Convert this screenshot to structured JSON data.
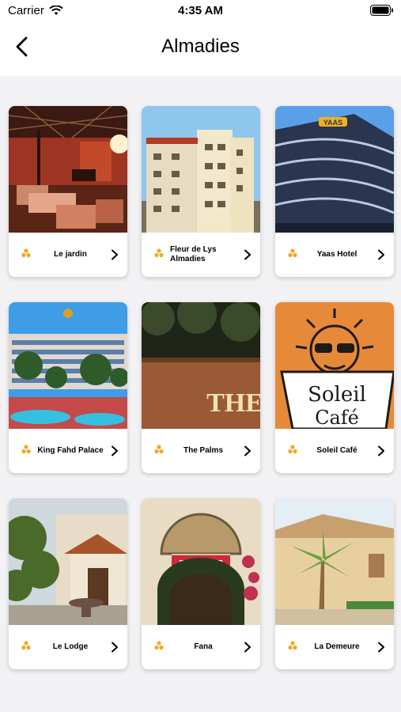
{
  "status_bar": {
    "carrier": "Carrier",
    "time": "4:35 AM"
  },
  "header": {
    "title": "Almadies"
  },
  "hotels": [
    {
      "name": "Le jardin"
    },
    {
      "name": "Fleur de Lys Almadies"
    },
    {
      "name": "Yaas Hotel"
    },
    {
      "name": "King Fahd Palace"
    },
    {
      "name": "The Palms"
    },
    {
      "name": "Soleil Café"
    },
    {
      "name": "Le Lodge"
    },
    {
      "name": "Fana"
    },
    {
      "name": "La Demeure"
    }
  ],
  "photo_text": {
    "palms_sign": "THE",
    "cafe_line1": "Soleil",
    "cafe_line2": "Café",
    "yaas_logo": "YAAS"
  },
  "colors": {
    "accent": "#f5a623",
    "page_bg": "#f2f2f4"
  },
  "icons": {
    "back": "chevron-left-icon",
    "item": "pin-cluster-icon",
    "row": "chevron-right-icon"
  }
}
